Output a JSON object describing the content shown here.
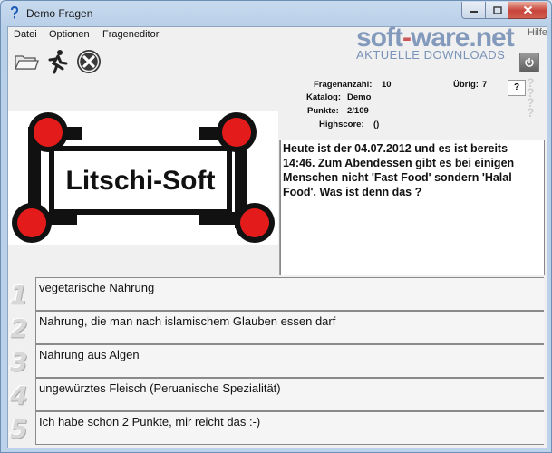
{
  "window": {
    "title": "Demo Fragen"
  },
  "menu": [
    "Datei",
    "Optionen",
    "Frageneditor"
  ],
  "menu_right": "Hilfe",
  "watermark": {
    "brand_left": "soft",
    "brand_dash": "-",
    "brand_right": "ware.net",
    "sub": "AKTUELLE DOWNLOADS"
  },
  "toolbar": {
    "open_icon": "folder-open-icon",
    "run_icon": "running-man-icon",
    "close_icon": "close-circle-icon",
    "power_icon": "power-icon"
  },
  "stats": {
    "fragenanzahl_label": "Fragenanzahl:",
    "fragenanzahl_value": "10",
    "uebrig_label": "Übrig:",
    "uebrig_value": "7",
    "katalog_label": "Katalog:",
    "katalog_value": "Demo",
    "punkte_label": "Punkte:",
    "punkte_value": "2/109",
    "highscore_label": "Highscore:",
    "highscore_value": "()"
  },
  "help_button": "?",
  "logo": {
    "text": "Litschi-Soft"
  },
  "question": "Heute ist der 04.07.2012 und es ist bereits 14:46. Zum Abendessen gibt es bei einigen Menschen nicht 'Fast Food' sondern 'Halal Food'. Was ist denn das ?",
  "answers": [
    {
      "num": "1",
      "text": "vegetarische Nahrung"
    },
    {
      "num": "2",
      "text": "Nahrung, die man nach islamischem Glauben essen darf"
    },
    {
      "num": "3",
      "text": "Nahrung aus Algen"
    },
    {
      "num": "4",
      "text": "ungewürztes Fleisch (Peruanische Spezialität)"
    },
    {
      "num": "5",
      "text": "Ich habe schon 2 Punkte, mir reicht das :-)"
    }
  ]
}
